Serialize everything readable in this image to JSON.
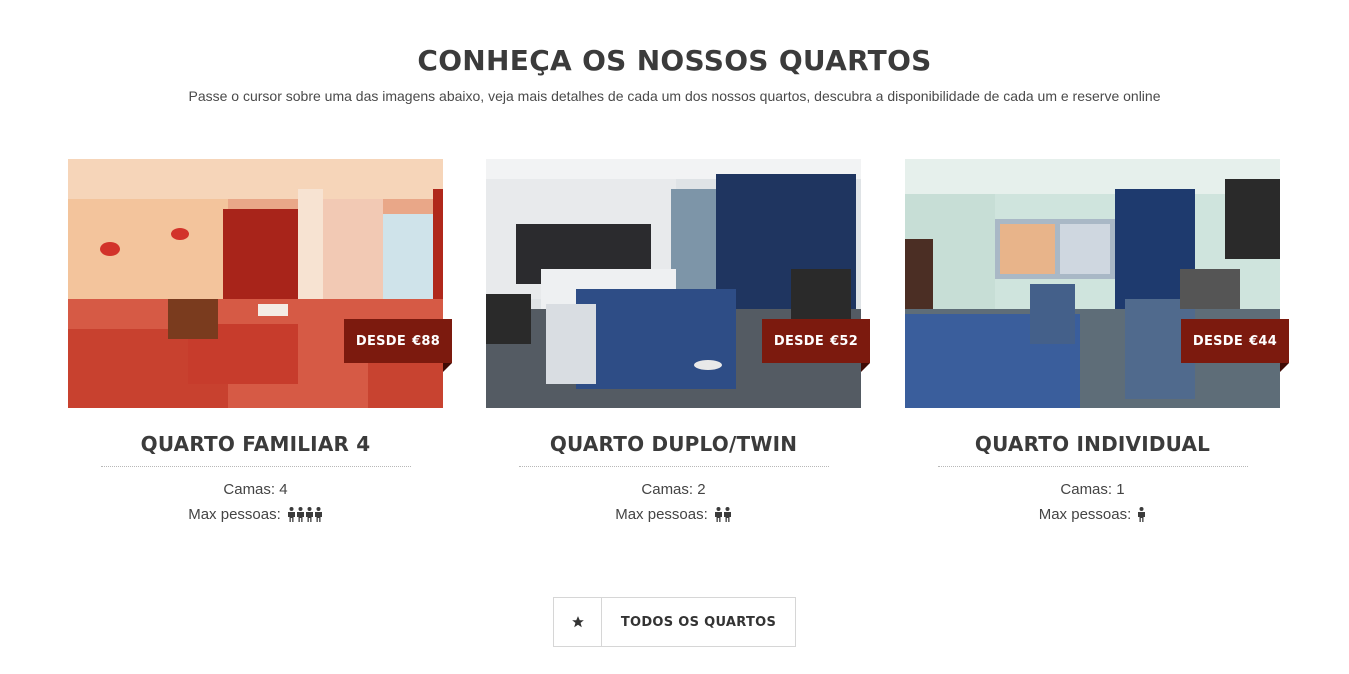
{
  "header": {
    "title": "CONHEÇA OS NOSSOS QUARTOS",
    "subtitle": "Passe o cursor sobre uma das imagens abaixo, veja mais detalhes de cada um dos nossos quartos, descubra a disponibilidade de cada um e reserve online"
  },
  "rooms": [
    {
      "name": "QUARTO FAMILIAR 4",
      "price_prefix": "DESDE",
      "price": "€88",
      "beds": "Camas: 4",
      "max_label": "Max pessoas:",
      "max_guests": 4,
      "person_icon": "person-icon"
    },
    {
      "name": "QUARTO DUPLO/TWIN",
      "price_prefix": "DESDE",
      "price": "€52",
      "beds": "Camas: 2",
      "max_label": "Max pessoas:",
      "max_guests": 2,
      "person_icon": "person-icon"
    },
    {
      "name": "QUARTO INDIVIDUAL",
      "price_prefix": "DESDE",
      "price": "€44",
      "beds": "Camas: 1",
      "max_label": "Max pessoas:",
      "max_guests": 1,
      "person_icon": "person-icon"
    }
  ],
  "cta": {
    "label": "TODOS OS QUARTOS",
    "icon": "star-icon"
  },
  "colors": {
    "price_tag": "#7c1a0e",
    "text_dark": "#3b3b3b"
  }
}
